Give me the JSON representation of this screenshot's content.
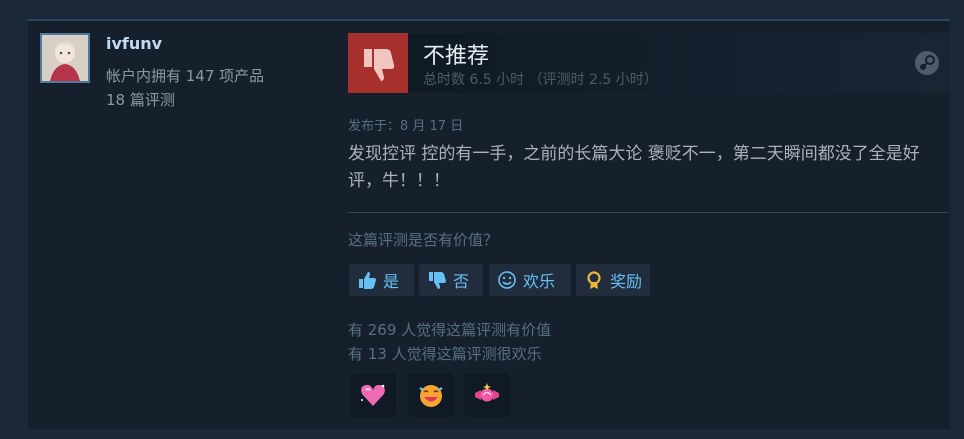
{
  "user": {
    "name": "ivfunv",
    "products": "帐户内拥有 147 项产品",
    "reviews": "18 篇评测"
  },
  "review": {
    "verdict": "不推荐",
    "hours": "总时数 6.5 小时  （评测时 2.5 小时）",
    "posted": "发布于：8 月 17 日",
    "body": "发现控评 控的有一手，之前的长篇大论 褒贬不一，第二天瞬间都没了全是好评，牛！！！"
  },
  "feedback": {
    "question": "这篇评测是否有价值？",
    "yes_label": "是",
    "no_label": "否",
    "funny_label": "欢乐",
    "award_label": "奖励",
    "helpful_count": "有 269 人觉得这篇评测有价值",
    "funny_count": "有 13 人觉得这篇评测很欢乐"
  },
  "colors": {
    "background": "#1b2838",
    "card": "#16202d",
    "thumb_down": "#a8302c",
    "link": "#66c0f4"
  },
  "icons": [
    "thumbs-down-icon",
    "steam-logo-icon",
    "thumbs-up-icon",
    "thumbs-down-icon",
    "smiley-icon",
    "award-icon",
    "heart-reaction-icon",
    "laughing-reaction-icon",
    "candy-reaction-icon"
  ]
}
